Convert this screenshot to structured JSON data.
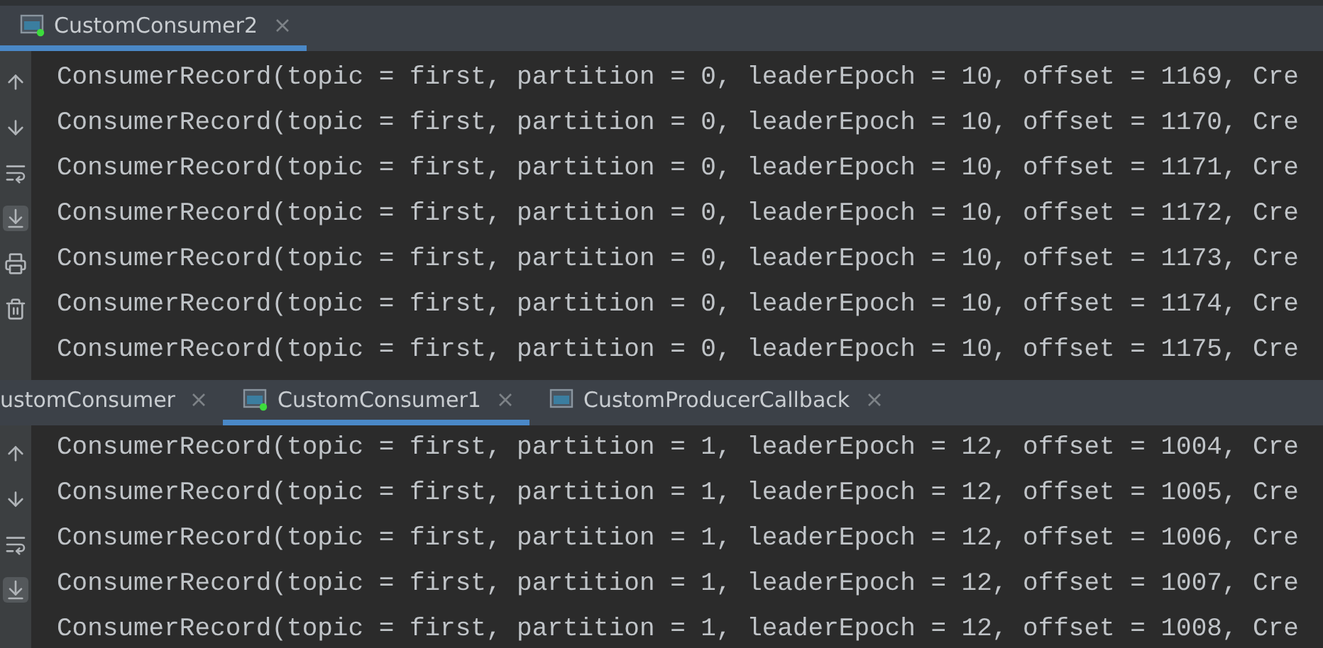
{
  "panels": [
    {
      "tabs": [
        {
          "label": "CustomConsumer2",
          "selected": true,
          "kind": "running"
        }
      ],
      "toolbar": [
        {
          "kind": "up",
          "active": false
        },
        {
          "kind": "down",
          "active": false
        },
        {
          "kind": "wrap",
          "active": false
        },
        {
          "kind": "scroll-end",
          "active": true
        },
        {
          "kind": "print",
          "active": false
        },
        {
          "kind": "trash",
          "active": false
        }
      ],
      "lines": [
        "ConsumerRecord(topic = first, partition = 0, leaderEpoch = 10, offset = 1169, Cre",
        "ConsumerRecord(topic = first, partition = 0, leaderEpoch = 10, offset = 1170, Cre",
        "ConsumerRecord(topic = first, partition = 0, leaderEpoch = 10, offset = 1171, Cre",
        "ConsumerRecord(topic = first, partition = 0, leaderEpoch = 10, offset = 1172, Cre",
        "ConsumerRecord(topic = first, partition = 0, leaderEpoch = 10, offset = 1173, Cre",
        "ConsumerRecord(topic = first, partition = 0, leaderEpoch = 10, offset = 1174, Cre",
        "ConsumerRecord(topic = first, partition = 0, leaderEpoch = 10, offset = 1175, Cre"
      ]
    },
    {
      "tabs": [
        {
          "label": "ustomConsumer",
          "selected": false,
          "kind": "plain"
        },
        {
          "label": "CustomConsumer1",
          "selected": true,
          "kind": "running"
        },
        {
          "label": "CustomProducerCallback",
          "selected": false,
          "kind": "stopped"
        }
      ],
      "toolbar": [
        {
          "kind": "up",
          "active": false
        },
        {
          "kind": "down",
          "active": false
        },
        {
          "kind": "wrap",
          "active": false
        },
        {
          "kind": "scroll-end",
          "active": true
        }
      ],
      "lines": [
        "ConsumerRecord(topic = first, partition = 1, leaderEpoch = 12, offset = 1004, Cre",
        "ConsumerRecord(topic = first, partition = 1, leaderEpoch = 12, offset = 1005, Cre",
        "ConsumerRecord(topic = first, partition = 1, leaderEpoch = 12, offset = 1006, Cre",
        "ConsumerRecord(topic = first, partition = 1, leaderEpoch = 12, offset = 1007, Cre",
        "ConsumerRecord(topic = first, partition = 1, leaderEpoch = 12, offset = 1008, Cre"
      ]
    }
  ]
}
